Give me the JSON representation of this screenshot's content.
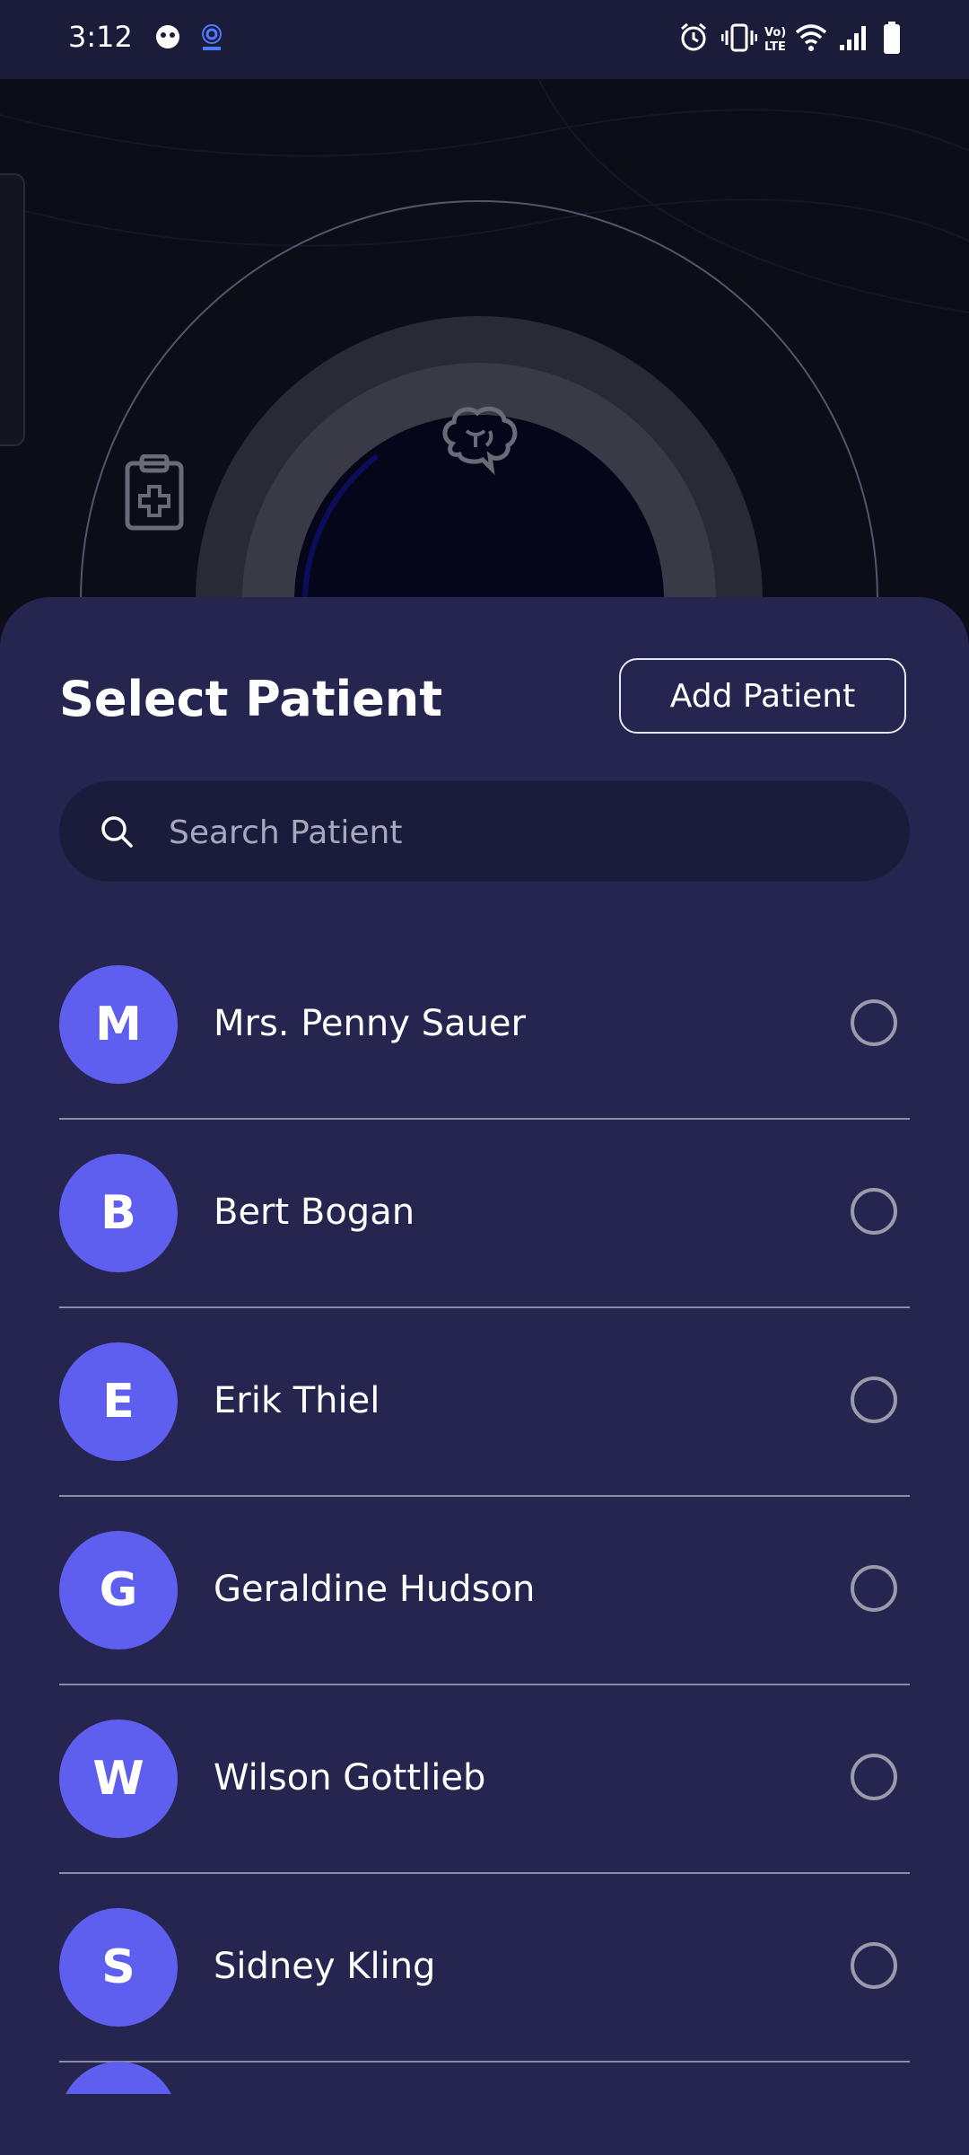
{
  "status_bar": {
    "time": "3:12",
    "left_icons": [
      "ghost-icon",
      "hotspot-icon"
    ],
    "right_icons": [
      "alarm-icon",
      "vibrate-icon",
      "volte-icon",
      "wifi-icon",
      "signal-icon",
      "battery-icon"
    ],
    "volte_text": "Vo) LTE"
  },
  "background": {
    "icons": [
      "clipboard-medical-icon",
      "brain-icon"
    ]
  },
  "sheet": {
    "title": "Select Patient",
    "add_button_label": "Add Patient",
    "search": {
      "placeholder": "Search Patient",
      "value": ""
    },
    "patients": [
      {
        "initial": "M",
        "name": "Mrs. Penny Sauer",
        "selected": false
      },
      {
        "initial": "B",
        "name": "Bert Bogan",
        "selected": false
      },
      {
        "initial": "E",
        "name": "Erik Thiel",
        "selected": false
      },
      {
        "initial": "G",
        "name": "Geraldine Hudson",
        "selected": false
      },
      {
        "initial": "W",
        "name": "Wilson Gottlieb",
        "selected": false
      },
      {
        "initial": "S",
        "name": "Sidney Kling",
        "selected": false
      }
    ]
  },
  "colors": {
    "sheet_bg": "#262550",
    "avatar_bg": "#5f5fef",
    "status_bar_bg": "#1b1b3a",
    "search_bg": "#1b1b3c"
  }
}
